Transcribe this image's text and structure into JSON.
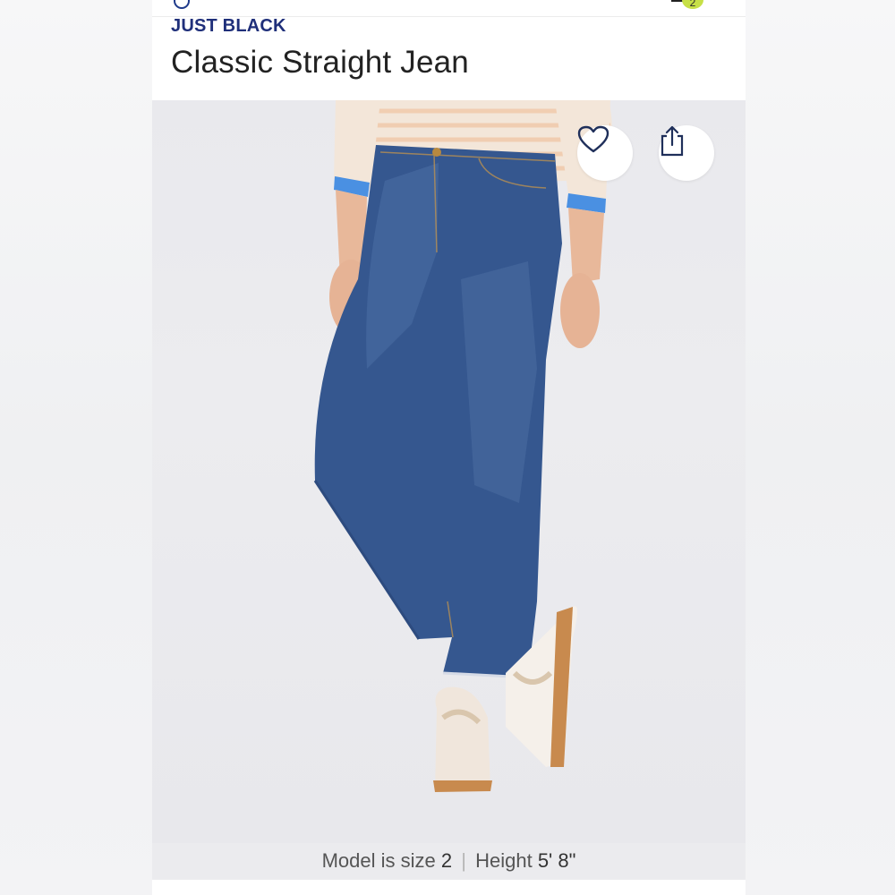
{
  "header": {
    "cart_count": "2"
  },
  "product": {
    "brand": "JUST BLACK",
    "title": "Classic Straight Jean"
  },
  "icons": {
    "favorite": "heart-icon",
    "share": "share-icon"
  },
  "caption": {
    "size_label": "Model is size",
    "size_value": "2",
    "separator": "|",
    "height_label": "Height",
    "height_value": "5' 8\""
  },
  "colors": {
    "brand_navy": "#1f2f7a",
    "denim": "#35578f",
    "badge": "#c7e047"
  }
}
